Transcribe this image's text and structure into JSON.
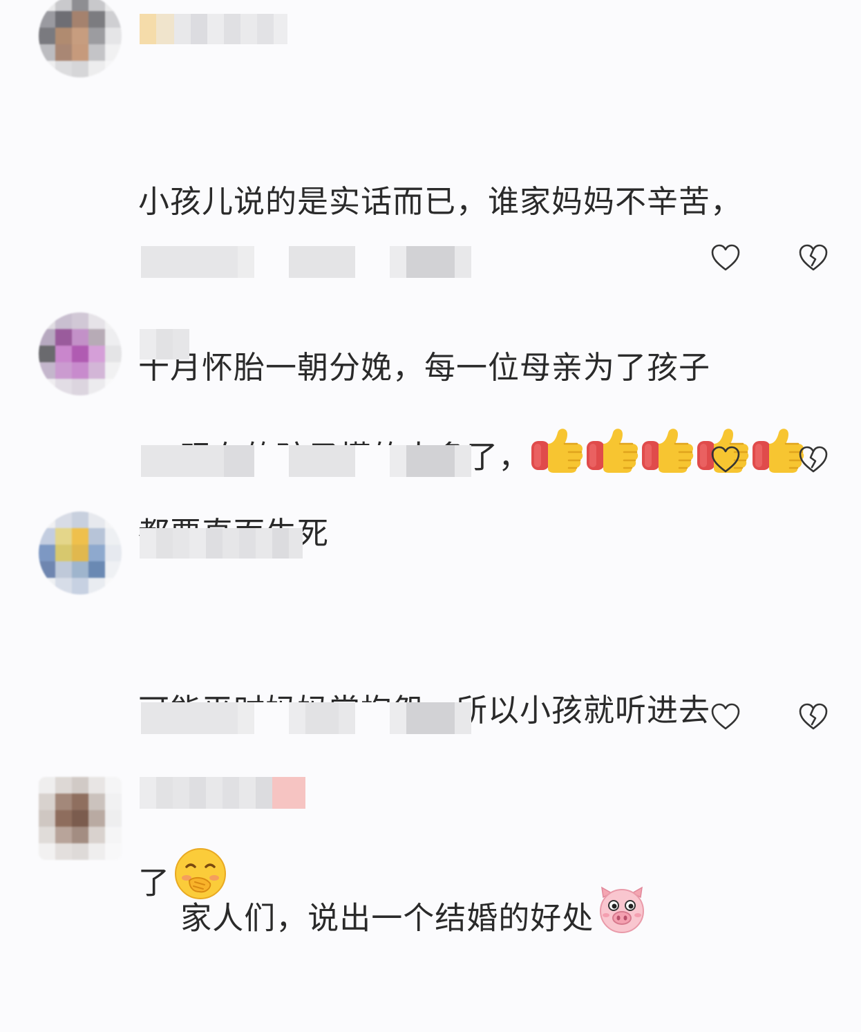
{
  "comments": [
    {
      "text_line1": "小孩儿说的是实话而已，谁家妈妈不辛苦，",
      "text_line2": "十月怀胎一朝分娩，每一位母亲为了孩子",
      "text_line3": "都要直面生死",
      "emojis": []
    },
    {
      "text_line1": "现在的孩子懂的太多了，",
      "emojis": [
        "thumbs-up",
        "thumbs-up",
        "thumbs-up",
        "thumbs-up",
        "thumbs-up"
      ]
    },
    {
      "text_line1": "可能平时妈妈常抱怨，所以小孩就听进去",
      "text_line2": "了",
      "emojis": [
        "blushing-covering-mouth"
      ]
    },
    {
      "text_line1": "家人们，说出一个结婚的好处",
      "emojis": [
        "pig-face"
      ]
    }
  ],
  "icons": {
    "like": "heart-outline-icon",
    "dislike": "broken-heart-outline-icon"
  },
  "colors": {
    "icon_stroke": "#333333",
    "text": "#2a2a2a"
  }
}
